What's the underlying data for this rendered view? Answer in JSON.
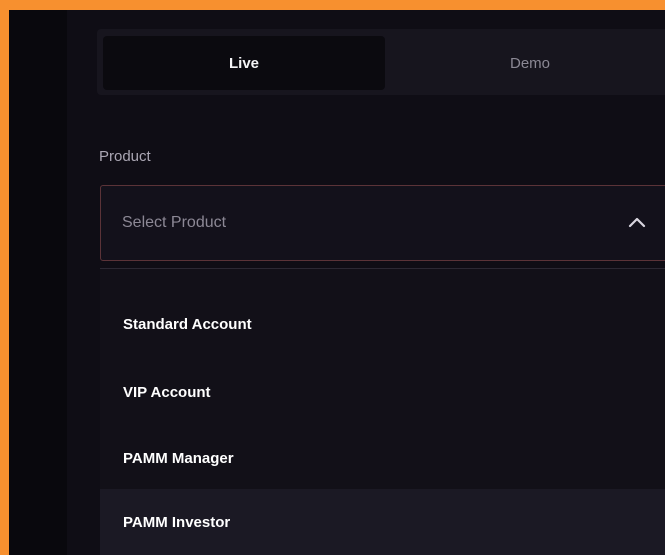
{
  "account_type_tabs": {
    "live_label": "Live",
    "demo_label": "Demo",
    "selected": "Live"
  },
  "product": {
    "label": "Product",
    "placeholder": "Select Product",
    "options": [
      "Standard Account",
      "VIP Account",
      "PAMM Manager",
      "PAMM Investor"
    ],
    "highlighted": "PAMM Investor"
  },
  "colors": {
    "background_frame": "#f7902f",
    "panel": "#0f0d15",
    "select_border": "#5b3338"
  },
  "icons": {
    "select_toggle": "chevron-up-icon"
  }
}
